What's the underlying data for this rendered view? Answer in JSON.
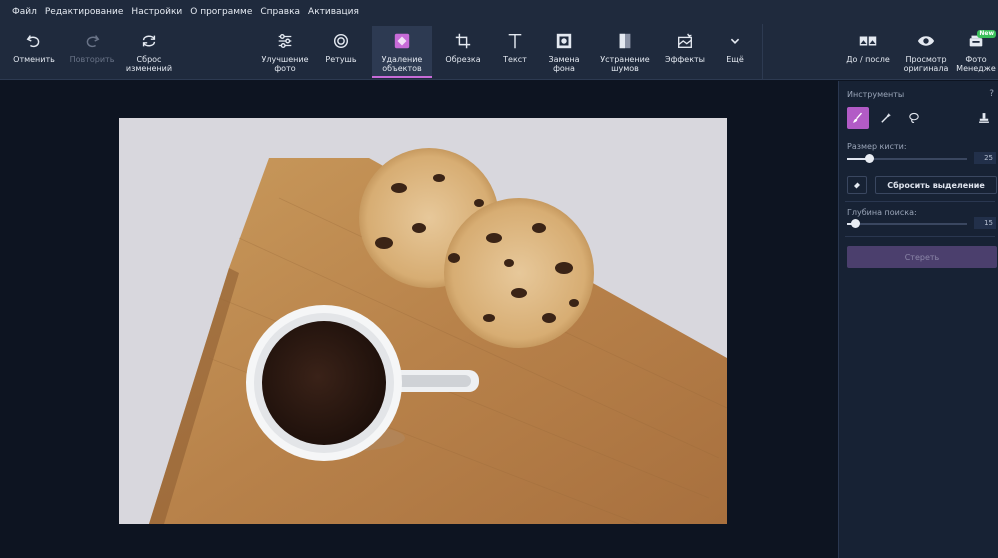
{
  "menu": [
    "Файл",
    "Редактирование",
    "Настройки",
    "О программе",
    "Справка",
    "Активация"
  ],
  "toolbar": {
    "undo": "Отменить",
    "redo": "Повторить",
    "reset_line1": "Сброс",
    "reset_line2": "изменений",
    "enhance_line1": "Улучшение",
    "enhance_line2": "фото",
    "retouch": "Ретушь",
    "remove_line1": "Удаление",
    "remove_line2": "объектов",
    "crop": "Обрезка",
    "text": "Текст",
    "bg_line1": "Замена",
    "bg_line2": "фона",
    "noise_line1": "Устранение",
    "noise_line2": "шумов",
    "effects": "Эффекты",
    "more": "Ещё",
    "before_after": "До / после",
    "view_line1": "Просмотр",
    "view_line2": "оригинала",
    "photo_line1": "Фото",
    "photo_line2": "Менедже",
    "new_badge": "New"
  },
  "panel": {
    "title": "Инструменты",
    "help": "?",
    "brush_size_label": "Размер кисти:",
    "brush_size_value": "25",
    "brush_size_fraction": 0.18,
    "reset_selection": "Сбросить выделение",
    "search_depth_label": "Глубина поиска:",
    "search_depth_value": "15",
    "search_depth_fraction": 0.07,
    "erase": "Стереть"
  },
  "colors": {
    "accent": "#b25bc6",
    "toolbar_bg": "#1f2a3d",
    "canvas_bg": "#0d1421"
  }
}
